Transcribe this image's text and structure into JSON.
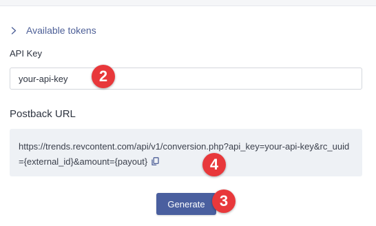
{
  "tokens": {
    "label": "Available tokens"
  },
  "api_key": {
    "label": "API Key",
    "value": "your-api-key"
  },
  "postback": {
    "label": "Postback URL",
    "url": "https://trends.revcontent.com/api/v1/conversion.php?api_key=your-api-key&rc_uuid={external_id}&amount={payout}"
  },
  "generate": {
    "label": "Generate"
  },
  "badges": {
    "api_key_step": "2",
    "copy_step": "4",
    "generate_step": "3"
  },
  "colors": {
    "accent": "#4a5f9f",
    "link": "#4d5f97",
    "badge": "#e8383b",
    "code_background": "#eef1f5"
  },
  "icons": {
    "toggle": "chevron-right-icon",
    "copy": "copy-icon"
  }
}
